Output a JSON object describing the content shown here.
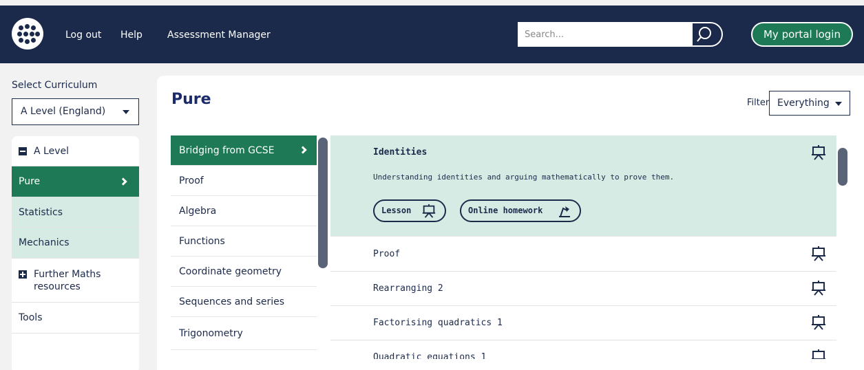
{
  "header": {
    "logout_label": "Log out",
    "help_label": "Help",
    "assessment_label": "Assessment Manager",
    "search_placeholder": "Search...",
    "portal_label": "My portal login"
  },
  "sidebar": {
    "select_label": "Select Curriculum",
    "selected_curriculum": "A Level (England)",
    "items": [
      {
        "label": "A Level"
      },
      {
        "label": "Pure"
      },
      {
        "label": "Statistics"
      },
      {
        "label": "Mechanics"
      },
      {
        "label": "Further Maths resources"
      },
      {
        "label": "Tools"
      }
    ]
  },
  "main": {
    "title": "Pure",
    "filter_label": "Filter",
    "filter_value": "Everything",
    "topics": [
      {
        "label": "Bridging from GCSE"
      },
      {
        "label": "Proof"
      },
      {
        "label": "Algebra"
      },
      {
        "label": "Functions"
      },
      {
        "label": "Coordinate geometry"
      },
      {
        "label": "Sequences and series"
      },
      {
        "label": "Trigonometry"
      }
    ],
    "featured": {
      "title": "Identities",
      "description": "Understanding identities and arguing mathematically to prove them.",
      "lesson_label": "Lesson",
      "homework_label": "Online homework"
    },
    "lessons": [
      {
        "label": "Proof"
      },
      {
        "label": "Rearranging 2"
      },
      {
        "label": "Factorising quadratics 1"
      },
      {
        "label": "Quadratic equations 1"
      }
    ]
  },
  "colors": {
    "navy": "#1b2a4a",
    "green": "#1e7a56",
    "mint": "#d5ebe3"
  }
}
